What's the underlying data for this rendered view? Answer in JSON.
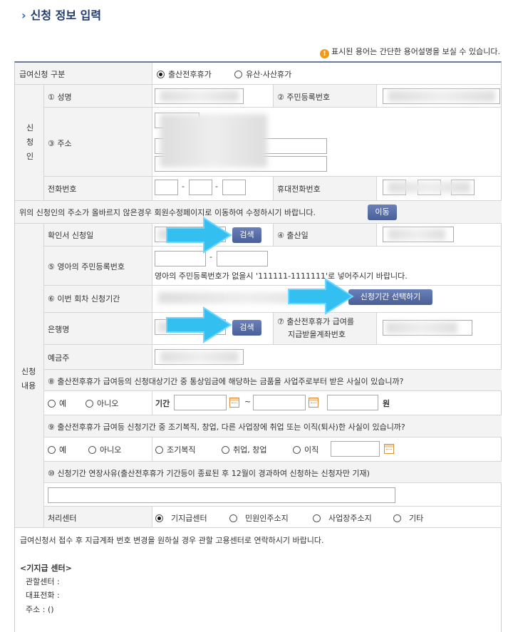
{
  "page": {
    "title": "신청 정보 입력",
    "notice": "표시된 용어는 간단한 용어설명을 보실 수 있습니다."
  },
  "type_row": {
    "label": "급여신청 구분",
    "options": [
      {
        "label": "출산전후휴가",
        "selected": true
      },
      {
        "label": "유산·사산휴가",
        "selected": false
      }
    ]
  },
  "applicant": {
    "group_label": "신\n청\n인",
    "name_label": "① 성명",
    "rrn_label": "② 주민등록번호",
    "address_label": "③ 주소",
    "phone_label": "전화번호",
    "mobile_label": "휴대전화번호",
    "dash": "-"
  },
  "address_notice": {
    "text": "위의 신청인의 주소가 올바르지 않은경우 회원수정페이지로 이동하여 수정하시기 바랍니다.",
    "button": "이동"
  },
  "content": {
    "group_label": "신청\n내용",
    "confirm_date_label": "확인서 신청일",
    "search_button": "검색",
    "birth_date_label": "④ 출산일",
    "infant_rrn_label": "⑤ 영아의 주민등록번호",
    "infant_note": "영아의 주민등록번호가 없을시 '111111-1111111'로 넣어주시기 바랍니다.",
    "period_label": "⑥ 이번 회차 신청기간",
    "period_button": "신청기간 선택하기",
    "bank_label": "은행명",
    "bank_search_button": "검색",
    "account_label_1": "⑦ 출산전후휴가 급여를",
    "account_label_2": "지급받을계좌번호",
    "holder_label": "예금주",
    "q8": "⑧ 출산전후휴가 급여등의 신청대상기간 중 통상임금에 해당하는 금품을 사업주로부터 받은 사실이 있습니까?",
    "q8_yes": "예",
    "q8_no": "아니오",
    "period_word": "기간",
    "tilde": "~",
    "won": "원",
    "q9": "⑨ 출산전후휴가 급여등 신청기간 중 조기복직, 창업, 다른 사업장에 취업 또는 이직(퇴사)한 사실이 있습니까?",
    "q9_yes": "예",
    "q9_no": "아니오",
    "q9_opt1": "조기복직",
    "q9_opt2": "취업, 창업",
    "q9_opt3": "이직",
    "q10": "⑩ 신청기간 연장사유(출산전후휴가 기간등이 종료된 후 12월이 경과하여 신청하는 신청자만 기재)",
    "center_label": "처리센터",
    "center_options": [
      {
        "label": "기지급센터",
        "selected": true
      },
      {
        "label": "민원인주소지",
        "selected": false
      },
      {
        "label": "사업장주소지",
        "selected": false
      },
      {
        "label": "기타",
        "selected": false
      }
    ]
  },
  "footer": {
    "note": "급여신청서 접수 후 지급계좌 번호 변경을 원하실 경우 관할 고용센터로 연락하시기 바랍니다.",
    "center_title": "<기지급 센터>",
    "jurisdiction": "관할센터 :",
    "phone": "대표전화 :",
    "address": "주소 : ()"
  },
  "colors": {
    "button": "#5067a6",
    "arrow": "#33bff0",
    "border": "#d6d6d6",
    "header_line": "#6a7a99"
  }
}
